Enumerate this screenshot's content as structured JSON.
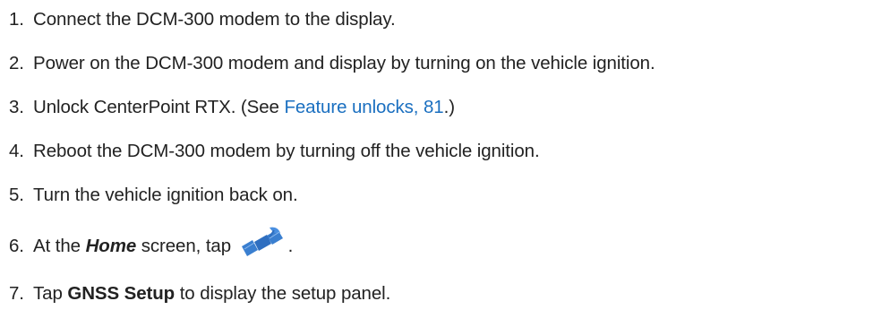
{
  "steps": [
    {
      "number": "1.",
      "text": "Connect the DCM-300 modem to the display."
    },
    {
      "number": "2.",
      "text": "Power on the DCM-300 modem and display by turning on the vehicle ignition."
    },
    {
      "number": "3.",
      "text_before": "Unlock CenterPoint RTX. (See ",
      "link": "Feature unlocks, 81",
      "text_after": ".)"
    },
    {
      "number": "4.",
      "text": "Reboot the DCM-300 modem by turning off the vehicle ignition."
    },
    {
      "number": "5.",
      "text": "Turn the vehicle ignition back on."
    },
    {
      "number": "6.",
      "text_before": "At the ",
      "emphasis": "Home",
      "text_middle": " screen, tap ",
      "icon": "satellite-icon",
      "text_after": "."
    },
    {
      "number": "7.",
      "text_before": "Tap ",
      "bold": "GNSS Setup",
      "text_after": " to display the setup panel."
    }
  ],
  "colors": {
    "text": "#222222",
    "link": "#1a6fc0",
    "icon": "#3a7fd0"
  }
}
